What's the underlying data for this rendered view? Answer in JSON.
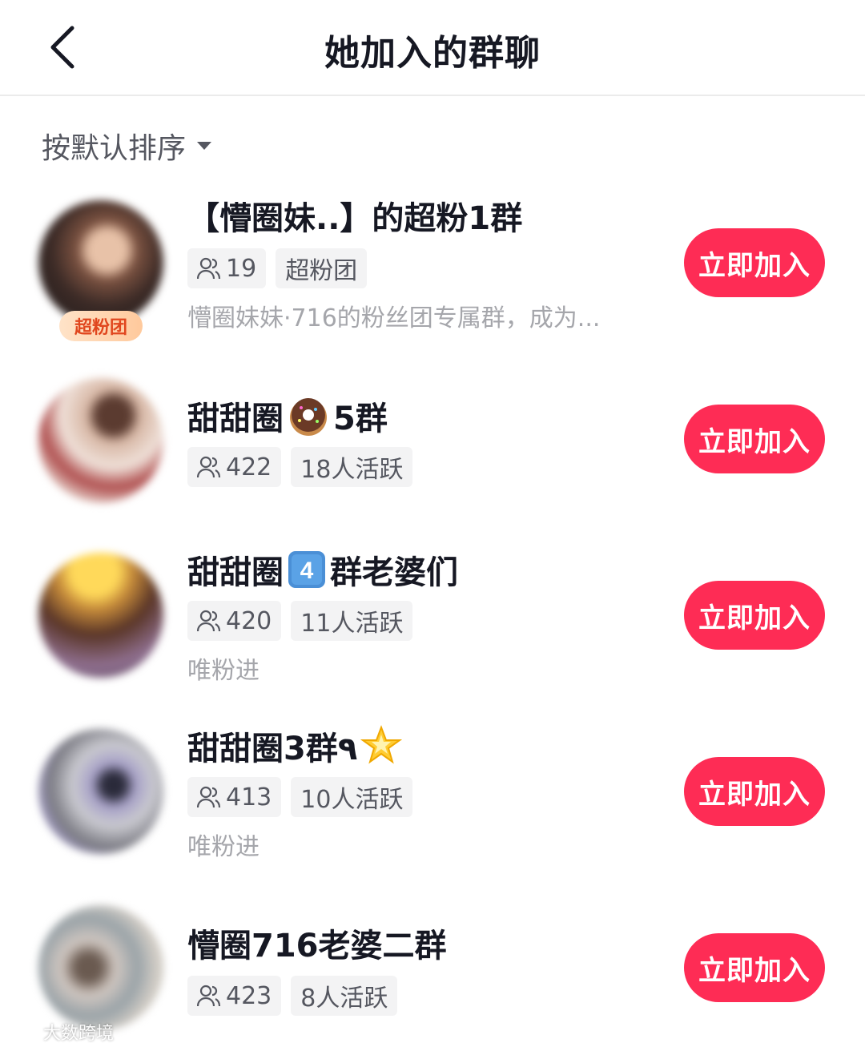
{
  "header": {
    "title": "她加入的群聊",
    "back_icon": "chevron-left-icon"
  },
  "sort": {
    "label": "按默认排序",
    "caret_icon": "caret-down-icon"
  },
  "join_label": "立即加入",
  "colors": {
    "accent": "#fe2c55",
    "tag_bg": "#f3f3f4",
    "muted": "#a5a6ab",
    "badge": "#e0461e"
  },
  "groups": [
    {
      "name_a": "【懵圈妹..】的超粉1群",
      "name_b": "",
      "emoji": "",
      "members": "19",
      "tag2": "超粉团",
      "desc": "懵圈妹妹·716的粉丝团专属群，成为...",
      "badge": "超粉团"
    },
    {
      "name_a": "甜甜圈",
      "emoji": "donut-emoji",
      "name_b": "5群",
      "members": "422",
      "tag2": "18人活跃",
      "desc": ""
    },
    {
      "name_a": "甜甜圈 ",
      "emoji": "keycap-4-emoji",
      "name_b": "群老婆们",
      "members": "420",
      "tag2": "11人活跃",
      "desc": "唯粉进"
    },
    {
      "name_a": "甜甜圈3群٩",
      "emoji": "glowing-star-emoji",
      "name_b": "",
      "members": "413",
      "tag2": "10人活跃",
      "desc": "唯粉进"
    },
    {
      "name_a": "懵圈716老婆二群",
      "name_b": "",
      "emoji": "",
      "members": "423",
      "tag2": "8人活跃",
      "desc": ""
    }
  ],
  "watermark": "大数跨境"
}
